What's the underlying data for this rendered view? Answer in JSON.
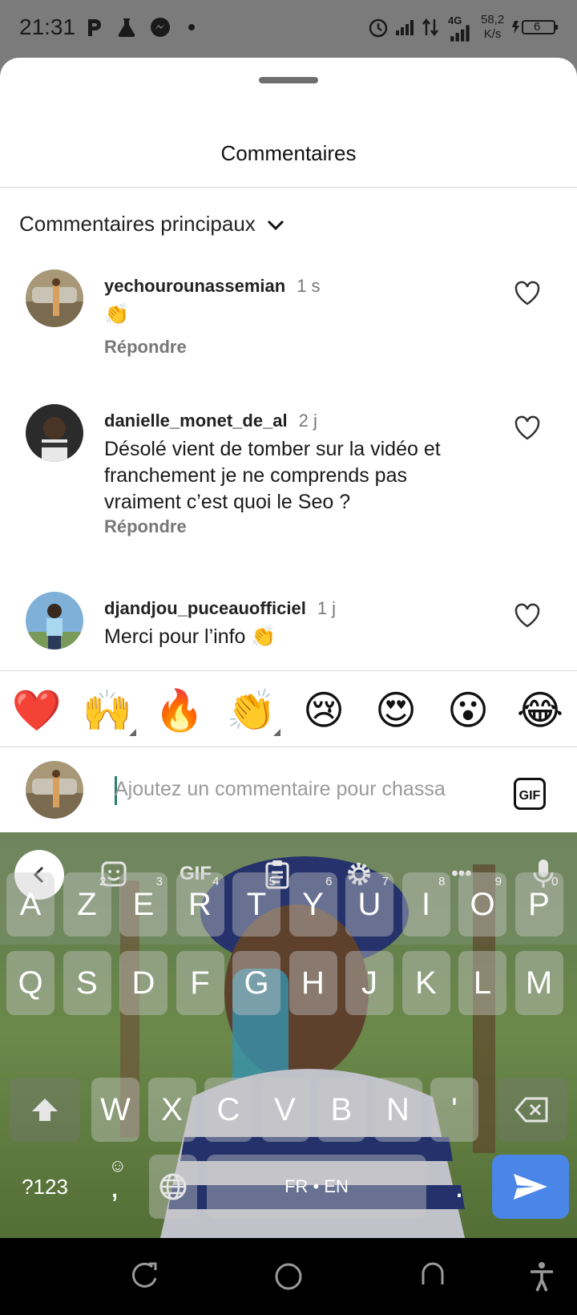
{
  "status_bar": {
    "time": "21:31",
    "network_label": "4G",
    "speed_value": "58,2",
    "speed_unit": "K/s",
    "battery": "6"
  },
  "sheet": {
    "title": "Commentaires",
    "sort_label": "Commentaires principaux"
  },
  "comments": [
    {
      "username": "yechourounassemian",
      "time_ago": "1 s",
      "text": "👏",
      "reply_label": "Répondre"
    },
    {
      "username": "danielle_monet_de_al",
      "time_ago": "2 j",
      "text": "Désolé vient de tomber sur la vidéo et franchement je ne comprends pas vraiment c’est quoi le Seo ?",
      "reply_label": "Répondre"
    },
    {
      "username": "djandjou_puceauofficiel",
      "time_ago": "1 j",
      "text": "Merci pour l’info 👏"
    }
  ],
  "reactions": [
    "❤️",
    "🙌",
    "🔥",
    "👏",
    "😢",
    "😍",
    "😮",
    "😂"
  ],
  "composer": {
    "placeholder": "Ajoutez un commentaire pour chassa",
    "gif_label": "GIF"
  },
  "keyboard": {
    "toolbar_gif": "GIF",
    "toolbar_more": "•••",
    "row1": [
      {
        "key": "A",
        "hint": "1"
      },
      {
        "key": "Z",
        "hint": "2"
      },
      {
        "key": "E",
        "hint": "3"
      },
      {
        "key": "R",
        "hint": "4"
      },
      {
        "key": "T",
        "hint": "5"
      },
      {
        "key": "Y",
        "hint": "6"
      },
      {
        "key": "U",
        "hint": "7"
      },
      {
        "key": "I",
        "hint": "8"
      },
      {
        "key": "O",
        "hint": "9"
      },
      {
        "key": "P",
        "hint": "0"
      }
    ],
    "row2": [
      "Q",
      "S",
      "D",
      "F",
      "G",
      "H",
      "J",
      "K",
      "L",
      "M"
    ],
    "row3": [
      "W",
      "X",
      "C",
      "V",
      "B",
      "N",
      "'"
    ],
    "symbols_label": "?123",
    "comma_label": ",",
    "emoji_hint": "☺",
    "space_label": "FR • EN",
    "period_label": "."
  },
  "colors": {
    "accent_send": "#4a86e8",
    "caret": "#2a7d6a",
    "status_bar_bg": "#7b7b7b"
  }
}
